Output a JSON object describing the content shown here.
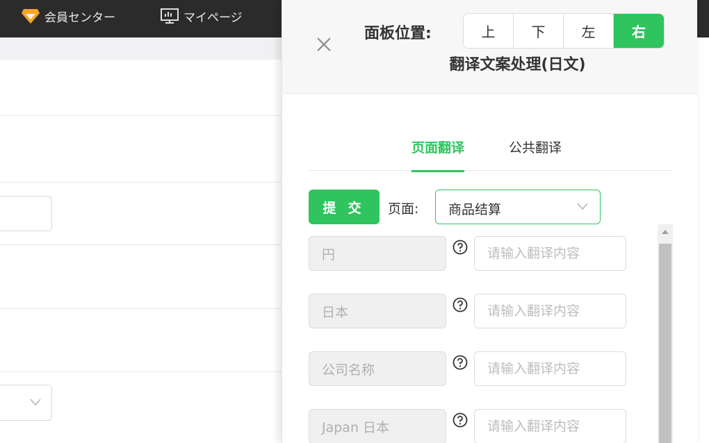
{
  "topbar": {
    "member_center": "会員センター",
    "my_page": "マイページ"
  },
  "panel": {
    "position_label": "面板位置:",
    "positions": [
      "上",
      "下",
      "左",
      "右"
    ],
    "active_position": "右",
    "title": "翻译文案处理(日文)",
    "tabs": [
      "页面翻译",
      "公共翻译"
    ],
    "active_tab": "页面翻译",
    "submit_label": "提 交",
    "page_label": "页面:",
    "page_value": "商品结算",
    "rows": [
      {
        "source": "円",
        "placeholder": "请输入翻译内容"
      },
      {
        "source": "日本",
        "placeholder": "请输入翻译内容"
      },
      {
        "source": "公司名称",
        "placeholder": "请输入翻译内容"
      },
      {
        "source": "Japan 日本",
        "placeholder": "请输入翻译内容"
      }
    ]
  },
  "colors": {
    "accent": "#2fc45d",
    "topbar": "#2b2b2b"
  }
}
